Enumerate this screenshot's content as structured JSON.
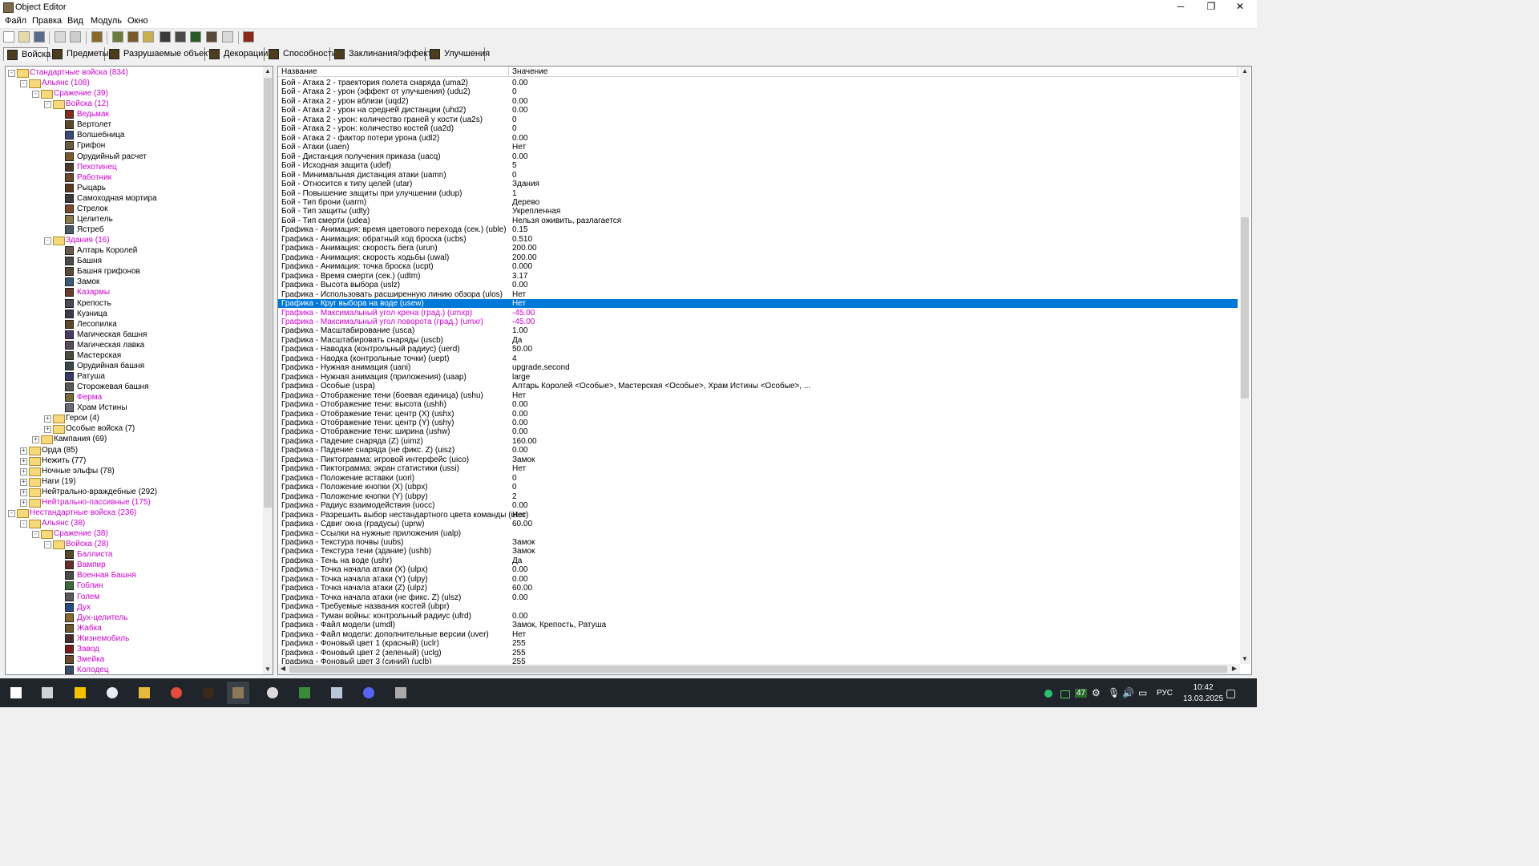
{
  "window": {
    "title": "Object Editor",
    "minimize": "─",
    "maximize": "❐",
    "close": "✕"
  },
  "menu": [
    "Файл",
    "Правка",
    "Вид",
    "Модуль",
    "Окно"
  ],
  "toolbar_icons": [
    "new-icon",
    "open-icon",
    "save-icon",
    "copy-icon",
    "paste-icon",
    "unit-icon",
    "terrain-icon",
    "doodad-icon",
    "sound-icon",
    "hero-icon",
    "camera-icon",
    "map-icon",
    "objects-icon",
    "import-icon",
    "report-icon"
  ],
  "tabs": [
    {
      "label": "Войска",
      "active": true
    },
    {
      "label": "Предметы"
    },
    {
      "label": "Разрушаемые объекты"
    },
    {
      "label": "Декорации"
    },
    {
      "label": "Способности"
    },
    {
      "label": "Заклинания/эффекты"
    },
    {
      "label": "Улучшения"
    }
  ],
  "tree": [
    {
      "label": "Стандартные войска (834)",
      "level": 0,
      "kind": "folder",
      "exp": "-",
      "mag": true
    },
    {
      "label": "Альянс (108)",
      "level": 1,
      "kind": "folder",
      "exp": "-",
      "mag": true
    },
    {
      "label": "Сражение (39)",
      "level": 2,
      "kind": "folder",
      "exp": "-",
      "mag": true
    },
    {
      "label": "Войска (12)",
      "level": 3,
      "kind": "folder",
      "exp": "-",
      "mag": true
    },
    {
      "label": "Ведьмак",
      "level": 4,
      "kind": "unit",
      "mag": true,
      "color": "#8a2a1a"
    },
    {
      "label": "Вертолет",
      "level": 4,
      "kind": "unit",
      "color": "#5a4a2a"
    },
    {
      "label": "Волшебница",
      "level": 4,
      "kind": "unit",
      "color": "#3a4a7a"
    },
    {
      "label": "Грифон",
      "level": 4,
      "kind": "unit",
      "color": "#6a5a3a"
    },
    {
      "label": "Орудийный расчет",
      "level": 4,
      "kind": "unit",
      "color": "#7a5a2a"
    },
    {
      "label": "Пехотинец",
      "level": 4,
      "kind": "unit",
      "mag": true,
      "color": "#4a3a2a"
    },
    {
      "label": "Работник",
      "level": 4,
      "kind": "unit",
      "mag": true,
      "color": "#6a4a2a"
    },
    {
      "label": "Рыцарь",
      "level": 4,
      "kind": "unit",
      "color": "#5a3a1a"
    },
    {
      "label": "Самоходная мортира",
      "level": 4,
      "kind": "unit",
      "color": "#3a3a3a"
    },
    {
      "label": "Стрелок",
      "level": 4,
      "kind": "unit",
      "color": "#7a4a2a"
    },
    {
      "label": "Целитель",
      "level": 4,
      "kind": "unit",
      "color": "#8a7a4a"
    },
    {
      "label": "Ястреб",
      "level": 4,
      "kind": "unit",
      "color": "#4a5a6a"
    },
    {
      "label": "Здания (16)",
      "level": 3,
      "kind": "folder",
      "exp": "-",
      "mag": true
    },
    {
      "label": "Алтарь Королей",
      "level": 4,
      "kind": "unit",
      "color": "#6a5a4a"
    },
    {
      "label": "Башня",
      "level": 4,
      "kind": "unit",
      "color": "#4a4a4a"
    },
    {
      "label": "Башня грифонов",
      "level": 4,
      "kind": "unit",
      "color": "#5a4a3a"
    },
    {
      "label": "Замок",
      "level": 4,
      "kind": "unit",
      "color": "#3a5a7a"
    },
    {
      "label": "Казармы",
      "level": 4,
      "kind": "unit",
      "mag": true,
      "color": "#6a3a2a"
    },
    {
      "label": "Крепость",
      "level": 4,
      "kind": "unit",
      "color": "#4a4a5a"
    },
    {
      "label": "Кузница",
      "level": 4,
      "kind": "unit",
      "color": "#3a3a4a"
    },
    {
      "label": "Лесопилка",
      "level": 4,
      "kind": "unit",
      "color": "#5a4a2a"
    },
    {
      "label": "Магическая башня",
      "level": 4,
      "kind": "unit",
      "color": "#4a3a6a"
    },
    {
      "label": "Магическая лавка",
      "level": 4,
      "kind": "unit",
      "color": "#5a4a5a"
    },
    {
      "label": "Мастерская",
      "level": 4,
      "kind": "unit",
      "color": "#4a4a3a"
    },
    {
      "label": "Орудийная башня",
      "level": 4,
      "kind": "unit",
      "color": "#3a4a4a"
    },
    {
      "label": "Ратуша",
      "level": 4,
      "kind": "unit",
      "color": "#3a3a6a"
    },
    {
      "label": "Сторожевая башня",
      "level": 4,
      "kind": "unit",
      "color": "#5a5a5a"
    },
    {
      "label": "Ферма",
      "level": 4,
      "kind": "unit",
      "mag": true,
      "color": "#7a6a3a"
    },
    {
      "label": "Храм Истины",
      "level": 4,
      "kind": "unit",
      "color": "#6a6a7a"
    },
    {
      "label": "Герои (4)",
      "level": 3,
      "kind": "folder",
      "exp": "+"
    },
    {
      "label": "Особые войска (7)",
      "level": 3,
      "kind": "folder",
      "exp": "+"
    },
    {
      "label": "Кампания (69)",
      "level": 2,
      "kind": "folder",
      "exp": "+"
    },
    {
      "label": "Орда (85)",
      "level": 1,
      "kind": "folder",
      "exp": "+"
    },
    {
      "label": "Нежить (77)",
      "level": 1,
      "kind": "folder",
      "exp": "+"
    },
    {
      "label": "Ночные эльфы (78)",
      "level": 1,
      "kind": "folder",
      "exp": "+"
    },
    {
      "label": "Наги (19)",
      "level": 1,
      "kind": "folder",
      "exp": "+"
    },
    {
      "label": "Нейтрально-враждебные (292)",
      "level": 1,
      "kind": "folder",
      "exp": "+"
    },
    {
      "label": "Нейтрально-пассивные (175)",
      "level": 1,
      "kind": "folder",
      "exp": "+",
      "mag": true
    },
    {
      "label": "Нестандартные войска (236)",
      "level": 0,
      "kind": "folder",
      "exp": "-",
      "mag": true
    },
    {
      "label": "Альянс (38)",
      "level": 1,
      "kind": "folder",
      "exp": "-",
      "mag": true
    },
    {
      "label": "Сражение (38)",
      "level": 2,
      "kind": "folder",
      "exp": "-",
      "mag": true
    },
    {
      "label": "Войска (28)",
      "level": 3,
      "kind": "folder",
      "exp": "-",
      "mag": true
    },
    {
      "label": "Баллиста",
      "level": 4,
      "kind": "unit",
      "mag": true,
      "color": "#5a4a2a"
    },
    {
      "label": "Вампир",
      "level": 4,
      "kind": "unit",
      "mag": true,
      "color": "#6a2a2a"
    },
    {
      "label": "Военная Башня",
      "level": 4,
      "kind": "unit",
      "mag": true,
      "color": "#4a4a4a"
    },
    {
      "label": "Гоблин",
      "level": 4,
      "kind": "unit",
      "mag": true,
      "color": "#3a6a3a"
    },
    {
      "label": "Голем",
      "level": 4,
      "kind": "unit",
      "mag": true,
      "color": "#5a5a5a"
    },
    {
      "label": "Дух",
      "level": 4,
      "kind": "unit",
      "mag": true,
      "color": "#2a4a8a"
    },
    {
      "label": "Дух-целитель",
      "level": 4,
      "kind": "unit",
      "mag": true,
      "color": "#8a6a2a"
    },
    {
      "label": "Жабка",
      "level": 4,
      "kind": "unit",
      "mag": true,
      "color": "#6a5a2a"
    },
    {
      "label": "Жизнемобиль",
      "level": 4,
      "kind": "unit",
      "mag": true,
      "color": "#4a2a2a"
    },
    {
      "label": "Завод",
      "level": 4,
      "kind": "unit",
      "mag": true,
      "color": "#7a1a1a"
    },
    {
      "label": "Змейка",
      "level": 4,
      "kind": "unit",
      "mag": true,
      "color": "#6a4a2a"
    },
    {
      "label": "Колодец",
      "level": 4,
      "kind": "unit",
      "mag": true,
      "color": "#3a4a6a"
    }
  ],
  "table": {
    "col_name": "Название",
    "col_value": "Значение",
    "rows": [
      [
        "Бой - Атака 2 - траектория полета снаряда (uma2)",
        "0.00"
      ],
      [
        "Бой - Атака 2 - урон (эффект от улучшения) (udu2)",
        "0"
      ],
      [
        "Бой - Атака 2 - урон вблизи (uqd2)",
        "0.00"
      ],
      [
        "Бой - Атака 2 - урон на средней дистанции (uhd2)",
        "0.00"
      ],
      [
        "Бой - Атака 2 - урон: количество граней у кости (ua2s)",
        "0"
      ],
      [
        "Бой - Атака 2 - урон: количество костей (ua2d)",
        "0"
      ],
      [
        "Бой - Атака 2 - фактор потери урона (udl2)",
        "0.00"
      ],
      [
        "Бой - Атаки (uaen)",
        "Нет"
      ],
      [
        "Бой - Дистанция получения приказа (uacq)",
        "0.00"
      ],
      [
        "Бой - Исходная защита (udef)",
        "5"
      ],
      [
        "Бой - Минимальная дистанция атаки (uamn)",
        "0"
      ],
      [
        "Бой - Относится к типу целей (utar)",
        "Здания"
      ],
      [
        "Бой - Повышение защиты при улучшении (udup)",
        "1"
      ],
      [
        "Бой - Тип брони (uarm)",
        "Дерево"
      ],
      [
        "Бой - Тип защиты (udty)",
        "Укрепленная"
      ],
      [
        "Бой - Тип смерти (udea)",
        "Нельзя оживить, разлагается"
      ],
      [
        "Графика - Анимация: время цветового перехода (сек.) (uble)",
        "0.15"
      ],
      [
        "Графика - Анимация: обратный ход броска (ucbs)",
        "0.510"
      ],
      [
        "Графика - Анимация: скорость бега (urun)",
        "200.00"
      ],
      [
        "Графика - Анимация: скорость ходьбы (uwal)",
        "200.00"
      ],
      [
        "Графика - Анимация: точка броска (ucpt)",
        "0.000"
      ],
      [
        "Графика - Время смерти (сек.) (udtm)",
        "3.17"
      ],
      [
        "Графика - Высота выбора (uslz)",
        "0.00"
      ],
      [
        "Графика - Использовать расширенную линию обзора (ulos)",
        "Нет"
      ],
      [
        "Графика - Круг выбора на воде (usew)",
        "Нет",
        "sel"
      ],
      [
        "Графика - Максимальный угол крена (град.) (umxp)",
        "-45.00",
        "mag"
      ],
      [
        "Графика - Максимальный угол поворота (град.) (umxr)",
        "-45.00",
        "mag"
      ],
      [
        "Графика - Масштабирование (usca)",
        "1.00"
      ],
      [
        "Графика - Масштабировать снаряды (uscb)",
        "Да"
      ],
      [
        "Графика - Наводка (контрольный радиус) (uerd)",
        "50.00"
      ],
      [
        "Графика - Наодка (контрольные точки) (uept)",
        "4"
      ],
      [
        "Графика - Нужная анимация (uani)",
        "upgrade,second"
      ],
      [
        "Графика - Нужная анимация (приложения) (uaap)",
        "large"
      ],
      [
        "Графика - Особые (uspa)",
        "Алтарь Королей <Особые>, Мастерская <Особые>, Храм Истины <Особые>, ..."
      ],
      [
        "Графика - Отображение тени (боевая единица) (ushu)",
        "Нет"
      ],
      [
        "Графика - Отображение тени: высота (ushh)",
        "0.00"
      ],
      [
        "Графика - Отображение тени: центр (X) (ushx)",
        "0.00"
      ],
      [
        "Графика - Отображение тени: центр (Y) (ushy)",
        "0.00"
      ],
      [
        "Графика - Отображение тени: ширина (ushw)",
        "0.00"
      ],
      [
        "Графика - Падение снаряда (Z) (uimz)",
        "160.00"
      ],
      [
        "Графика - Падение снаряда (не фикс. Z) (uisz)",
        "0.00"
      ],
      [
        "Графика - Пиктограмма: игровой интерфейс (uico)",
        "Замок"
      ],
      [
        "Графика - Пиктограмма: экран статистики (ussi)",
        "Нет"
      ],
      [
        "Графика - Положение вставки (uori)",
        "0"
      ],
      [
        "Графика - Положение кнопки (X) (ubpx)",
        "0"
      ],
      [
        "Графика - Положение кнопки (Y) (ubpy)",
        "2"
      ],
      [
        "Графика - Радиус взаимодействия (uocc)",
        "0.00"
      ],
      [
        "Графика - Разрешить выбор нестандартного цвета команды (utcc)",
        "Нет"
      ],
      [
        "Графика - Сдвиг окна (градусы) (uprw)",
        "60.00"
      ],
      [
        "Графика - Ссылки на нужные приложения (ualp)",
        ""
      ],
      [
        "Графика - Текстура почвы (uubs)",
        "Замок"
      ],
      [
        "Графика - Текстура тени (здание) (ushb)",
        "Замок"
      ],
      [
        "Графика - Тень на воде (ushr)",
        "Да"
      ],
      [
        "Графика - Точка начала атаки (X) (ulpx)",
        "0.00"
      ],
      [
        "Графика - Точка начала атаки (Y) (ulpy)",
        "0.00"
      ],
      [
        "Графика - Точка начала атаки (Z) (ulpz)",
        "60.00"
      ],
      [
        "Графика - Точка начала атаки (не фикс. Z) (ulsz)",
        "0.00"
      ],
      [
        "Графика - Требуемые названия костей (ubpr)",
        ""
      ],
      [
        "Графика - Туман войны: контрольный радиус (ufrd)",
        "0.00"
      ],
      [
        "Графика - Файл модели (umdl)",
        "Замок, Крепость, Ратуша"
      ],
      [
        "Графика - Файл модели: дополнительные версии (uver)",
        "Нет"
      ],
      [
        "Графика - Фоновый цвет 1 (красный) (uclr)",
        "255"
      ],
      [
        "Графика - Фоновый цвет 2 (зеленый) (uclg)",
        "255"
      ],
      [
        "Графика - Фоновый цвет 3 (синий) (uclb)",
        "255"
      ]
    ]
  },
  "taskbar": {
    "apps": [
      "start-icon",
      "task-view-icon",
      "headset-icon",
      "steam-icon",
      "file-explorer-icon",
      "chrome-icon",
      "app-round-icon",
      "object-editor-icon",
      "warcraft-icon",
      "notepad-icon",
      "window-app-icon",
      "discord-icon",
      "world-editor-icon"
    ],
    "tray_badge": "47",
    "lang": "РУС",
    "time": "10:42",
    "date": "13.03.2025"
  },
  "colors": {
    "highlight": "#0078d7",
    "magenta_modified": "#d000d0",
    "taskbar": "#20252b"
  }
}
